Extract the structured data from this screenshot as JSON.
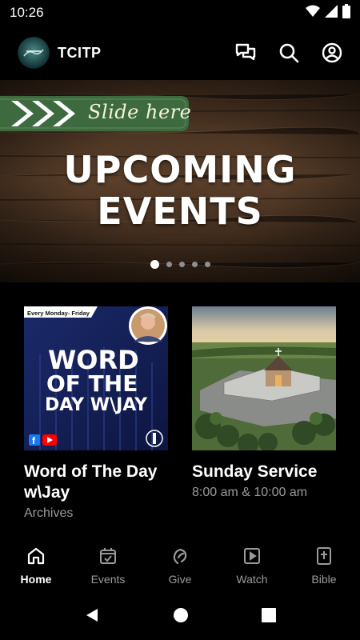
{
  "status": {
    "time": "10:26"
  },
  "header": {
    "app_title": "TCITP"
  },
  "hero": {
    "slide_label": "Slide here",
    "title_line1": "UPCOMING",
    "title_line2": "EVENTS",
    "dots_count": 5,
    "active_dot": 1
  },
  "cards": [
    {
      "title": "Word of The Day w\\Jay",
      "subtitle": "Archives",
      "thumb_banner": "Every Monday- Friday",
      "thumb_line1": "WORD",
      "thumb_line2": "OF THE",
      "thumb_line3": "DAY W\\JAY"
    },
    {
      "title": "Sunday Service",
      "subtitle": "8:00 am  & 10:00 am"
    }
  ],
  "nav": [
    {
      "label": "Home",
      "icon": "home-icon",
      "active": true
    },
    {
      "label": "Events",
      "icon": "calendar-icon",
      "active": false
    },
    {
      "label": "Give",
      "icon": "give-icon",
      "active": false
    },
    {
      "label": "Watch",
      "icon": "play-icon",
      "active": false
    },
    {
      "label": "Bible",
      "icon": "bible-icon",
      "active": false
    }
  ],
  "colors": {
    "background": "#000000",
    "accent_green": "#3e6a3f",
    "inactive": "#9a9a9a"
  }
}
